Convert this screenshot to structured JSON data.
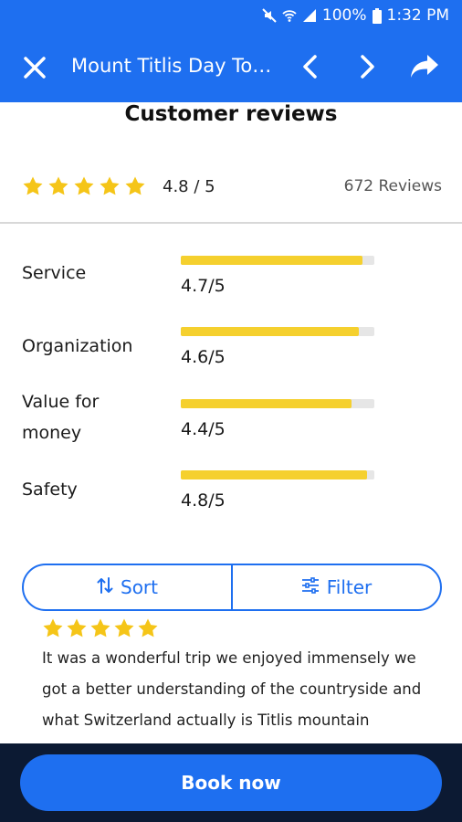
{
  "status_bar": {
    "battery": "100%",
    "time": "1:32 PM",
    "icons": [
      "mute-icon",
      "wifi-icon",
      "signal-icon",
      "battery-icon"
    ]
  },
  "header": {
    "title": "Mount Titlis Day Tour...",
    "icons": [
      "close-icon",
      "chevron-left-icon",
      "chevron-right-icon",
      "share-icon"
    ]
  },
  "reviews": {
    "section_title": "Customer reviews",
    "overall_score": "4.8 / 5",
    "overall_stars": 5,
    "review_count": "672 Reviews",
    "categories": [
      {
        "label": "Service",
        "value": "4.7/5",
        "fraction": 0.94
      },
      {
        "label": "Organization",
        "value": "4.6/5",
        "fraction": 0.92
      },
      {
        "label": "Value for money",
        "value": "4.4/5",
        "fraction": 0.88
      },
      {
        "label": "Safety",
        "value": "4.8/5",
        "fraction": 0.96
      }
    ]
  },
  "controls": {
    "sort_label": "Sort",
    "filter_label": "Filter"
  },
  "review_item": {
    "stars": 5,
    "text": "It was a wonderful trip we enjoyed immensely we got a better understanding of the countryside and what Switzerland actually is Titlis mountain"
  },
  "cta": {
    "book_label": "Book now"
  },
  "colors": {
    "brand_blue": "#1e6ff0",
    "star_yellow": "#f5c518",
    "bar_yellow": "#f5d02e",
    "bottom_bar": "#0c1a33"
  }
}
